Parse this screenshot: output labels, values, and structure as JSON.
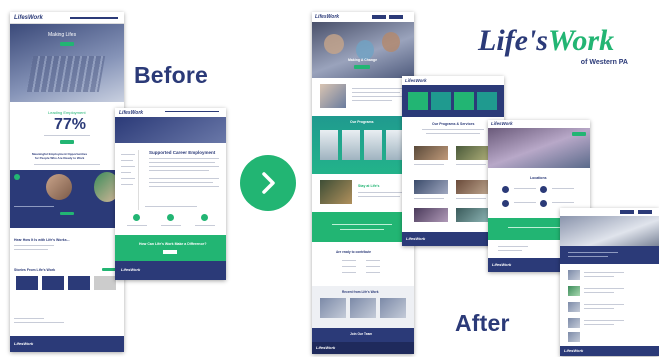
{
  "labels": {
    "before": "Before",
    "after": "After"
  },
  "logo": {
    "part1": "Life's",
    "part2": "Work",
    "subtitle": "of Western PA",
    "color_primary": "#2b3a78",
    "color_accent": "#22b573"
  },
  "before_shot": {
    "hero_title": "Making Lifes",
    "stat": "77%",
    "stat_caption": "Leading Employment",
    "tagline": "Meaningful Employment Opportunities\nfor People Who Are Ready to Work",
    "section_title": "Hear How It Is with Life's Works...",
    "news_title": "Stories From Life's Work",
    "footer_logo": "LifesWork"
  },
  "before_sub": {
    "title": "Supported Career Employment",
    "cta": "How Can Life's Work Make a Difference?",
    "footer_logo": "LifesWork"
  },
  "after_main": {
    "hero_text": "Making A Change",
    "section_programs": "Our Programs",
    "section_stories": "Stay at Life's",
    "section_help": "Are ready to contribute",
    "section_news": "Recent from Life's Work",
    "section_join": "Join Our Team",
    "footer_logo": "LifesWork"
  },
  "after_programs": {
    "title": "Our Programs & Services",
    "footer_logo": "LifesWork"
  },
  "after_detail": {
    "title": "Locations",
    "footer_logo": "LifesWork"
  },
  "after_blog": {
    "footer_logo": "LifesWork"
  },
  "icons": {
    "arrow": "chevron-right-icon"
  }
}
